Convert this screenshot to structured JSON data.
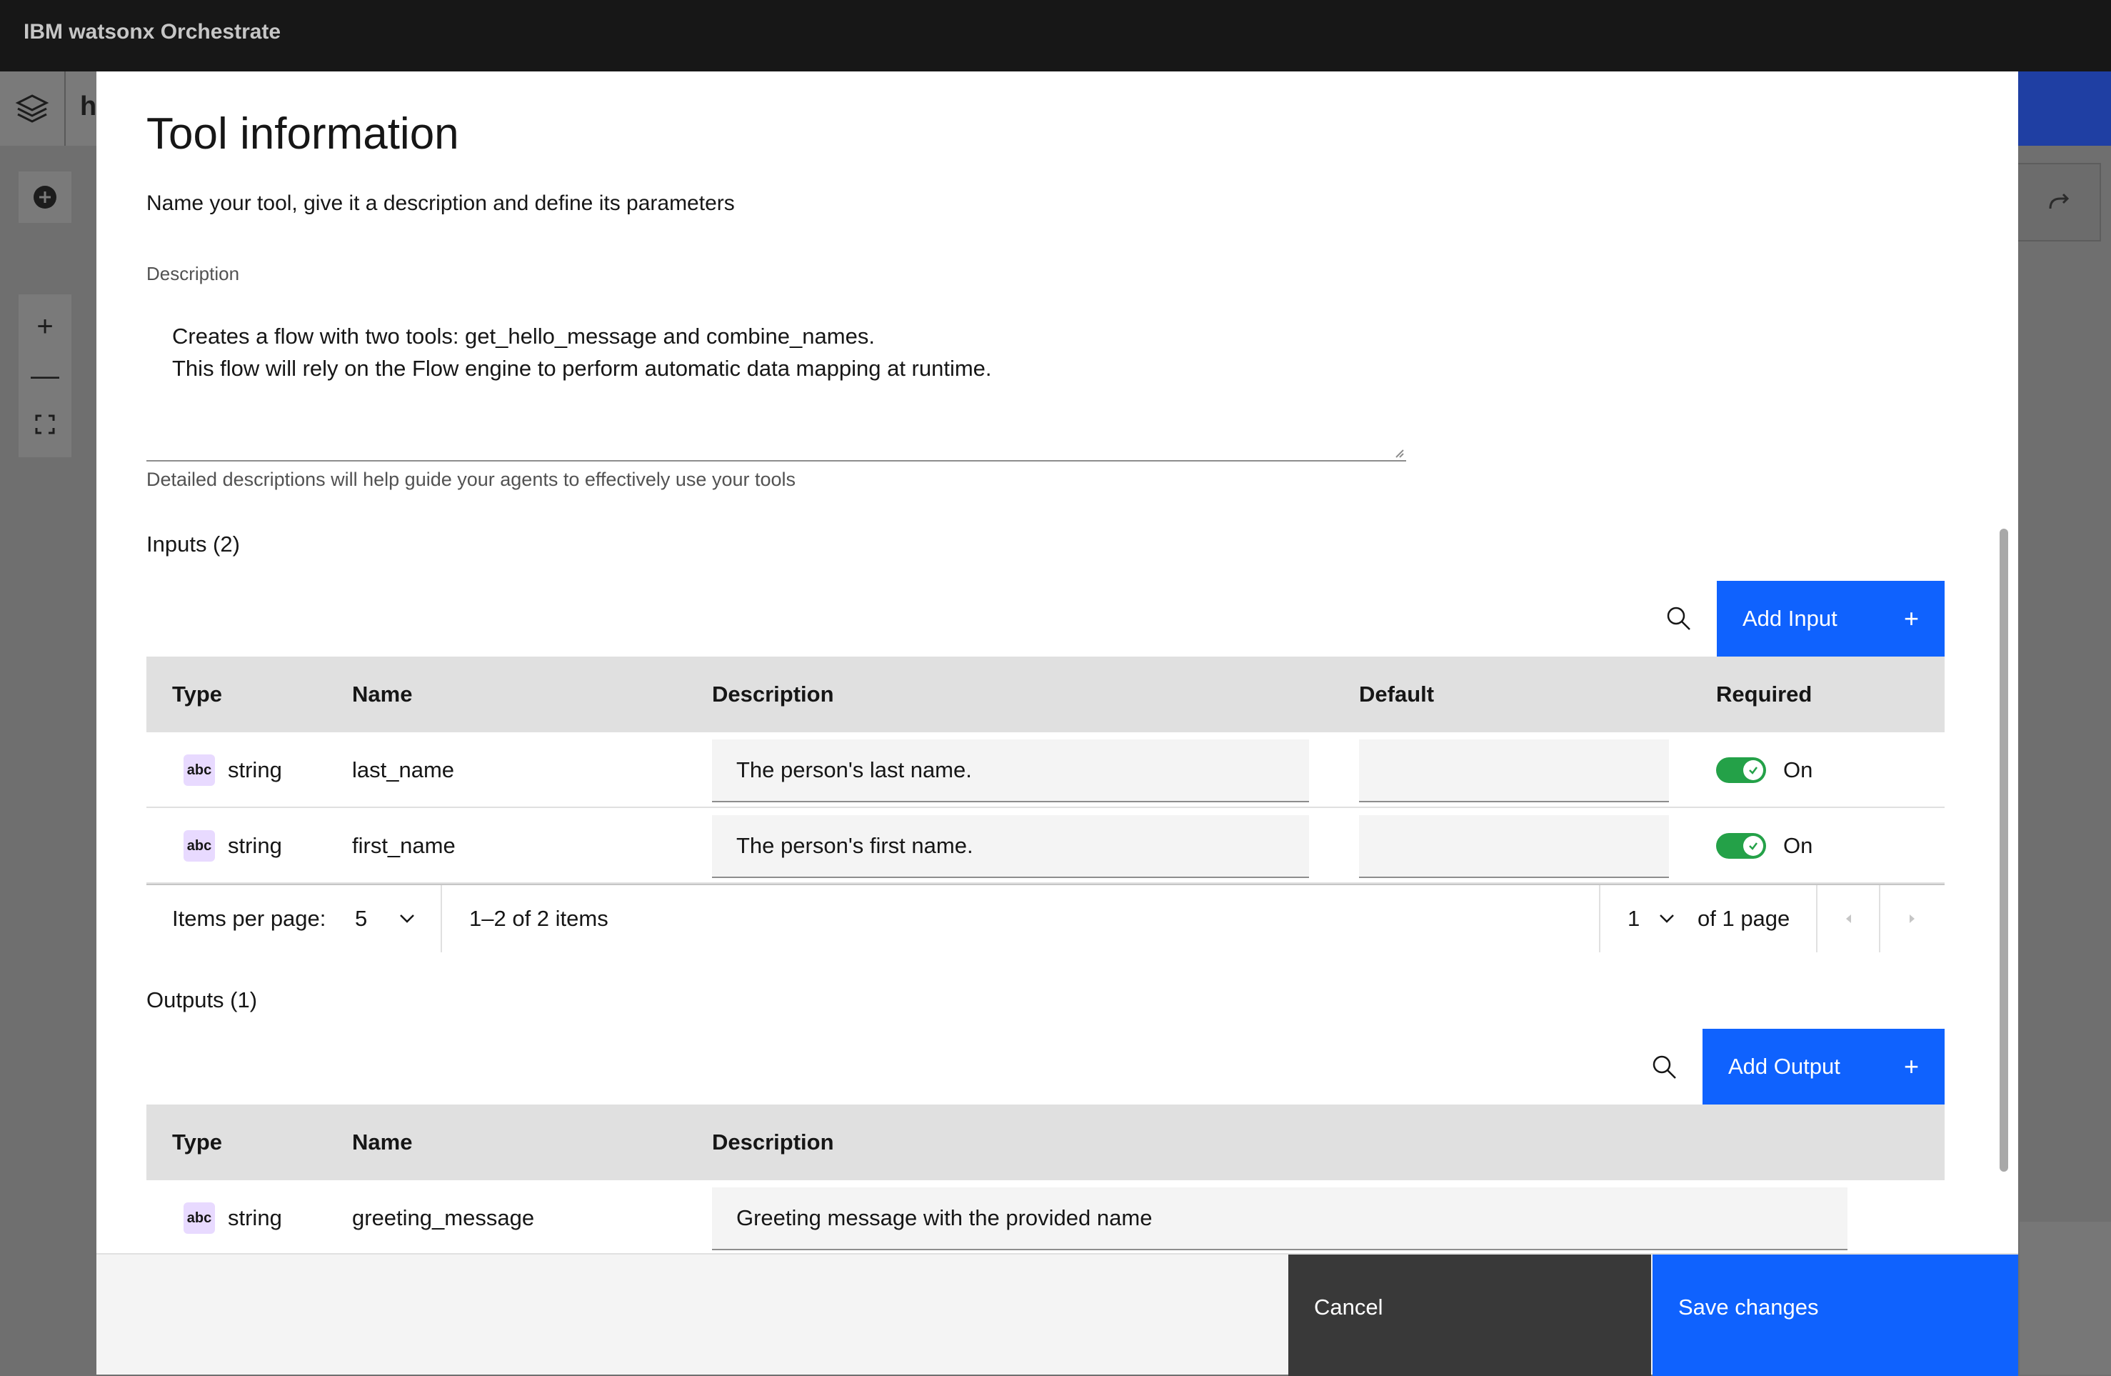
{
  "app": {
    "title": "IBM watsonx Orchestrate",
    "breadcrumb_fragment": "h"
  },
  "modal": {
    "title": "Tool information",
    "subtitle": "Name your tool, give it a description and define its parameters",
    "description_label": "Description",
    "description_lines": [
      "Creates a flow with two tools: get_hello_message and combine_names.",
      "This flow will rely on the Flow engine to perform automatic data mapping at runtime."
    ],
    "description_help": "Detailed descriptions will help guide your agents to effectively use your tools"
  },
  "inputs": {
    "title": "Inputs (2)",
    "add_label": "Add Input",
    "columns": [
      "Type",
      "Name",
      "Description",
      "Default",
      "Required"
    ],
    "rows": [
      {
        "type_badge": "abc",
        "type": "string",
        "name": "last_name",
        "description": "The person's last name.",
        "default": "",
        "required": "On"
      },
      {
        "type_badge": "abc",
        "type": "string",
        "name": "first_name",
        "description": "The person's first name.",
        "default": "",
        "required": "On"
      }
    ],
    "pagination": {
      "items_per_page_label": "Items per page:",
      "items_per_page": "5",
      "range": "1–2 of 2 items",
      "page": "1",
      "page_total": "of 1 page"
    }
  },
  "outputs": {
    "title": "Outputs (1)",
    "add_label": "Add Output",
    "columns": [
      "Type",
      "Name",
      "Description"
    ],
    "rows": [
      {
        "type_badge": "abc",
        "type": "string",
        "name": "greeting_message",
        "description": "Greeting message with the provided name"
      }
    ]
  },
  "footer": {
    "cancel": "Cancel",
    "save": "Save changes"
  },
  "colors": {
    "primary": "#0f62fe",
    "toggle_on": "#24a148",
    "type_badge": "#e8daff",
    "header_bg": "#171717"
  }
}
